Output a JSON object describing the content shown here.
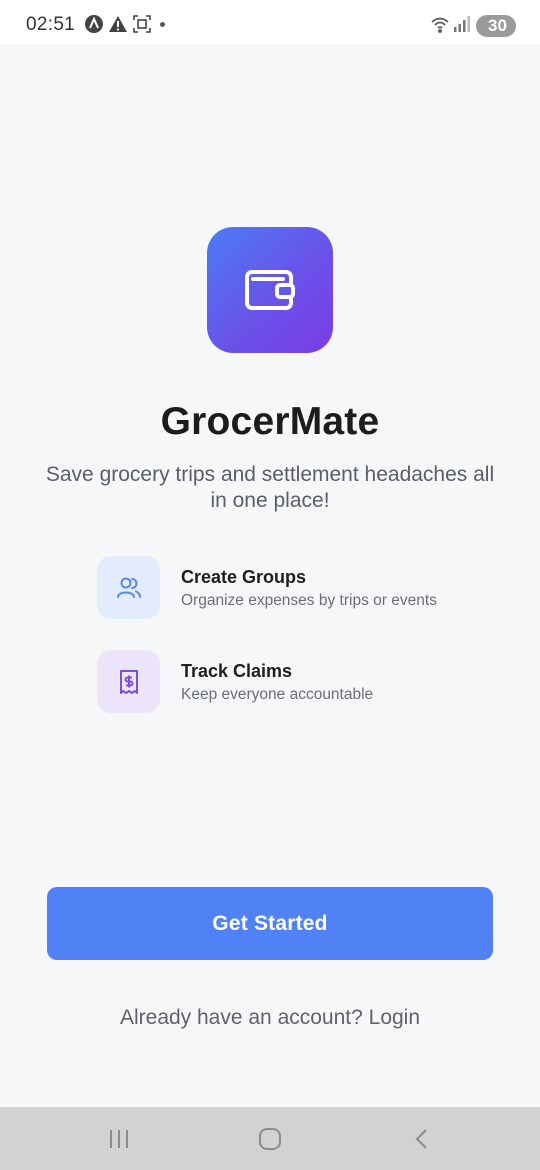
{
  "status_bar": {
    "time": "02:51",
    "battery": "30",
    "icons": [
      "notification-a-icon",
      "warning-icon",
      "screenshot-icon",
      "wifi-icon",
      "signal-icon",
      "battery-icon"
    ]
  },
  "app": {
    "logo_icon": "wallet-icon",
    "title": "GrocerMate",
    "tagline": "Save grocery trips and settlement headaches all in one place!"
  },
  "features": [
    {
      "icon": "users-icon",
      "title": "Create Groups",
      "description": "Organize expenses by trips or events",
      "icon_bg": "#e3ecfc",
      "icon_color": "#5b86e5"
    },
    {
      "icon": "receipt-icon",
      "title": "Track Claims",
      "description": "Keep everyone accountable",
      "icon_bg": "#ece4f8",
      "icon_color": "#7d4fd6"
    }
  ],
  "actions": {
    "get_started_label": "Get Started",
    "login_text": "Already have an account? Login"
  },
  "nav_bar": {
    "buttons": [
      "recents-icon",
      "home-icon",
      "back-icon"
    ]
  },
  "colors": {
    "primary": "#5182f5",
    "background": "#f6f7f9",
    "logo_gradient_start": "#4b7cf5",
    "logo_gradient_end": "#7a3ee3"
  }
}
